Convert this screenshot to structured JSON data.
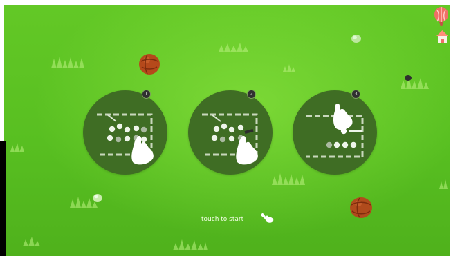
{
  "prompt": {
    "start_text": "touch to start"
  },
  "tutorial": {
    "steps": [
      {
        "number": "1",
        "icon": "tap-selection-icon"
      },
      {
        "number": "2",
        "icon": "drag-selection-icon"
      },
      {
        "number": "3",
        "icon": "swipe-selection-icon"
      }
    ]
  },
  "colors": {
    "field_green": "#58bf21",
    "card_green": "#3f6d24",
    "ball_orange": "#b04b1c",
    "text_light": "#f4ffe8"
  },
  "icons": {
    "hand": "hand-pointer-icon",
    "balloon": "balloon-icon",
    "house": "house-icon",
    "ball": "ball-icon",
    "stone": "stone-icon",
    "grass": "grass-icon"
  }
}
